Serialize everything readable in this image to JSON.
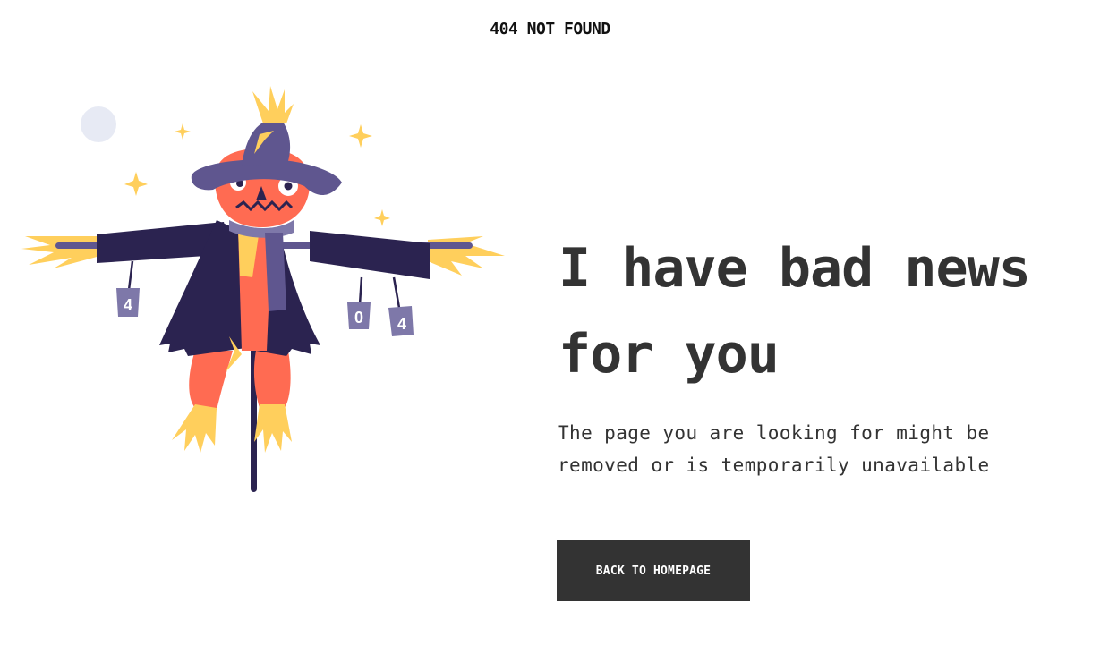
{
  "header": {
    "title": "404 NOT FOUND"
  },
  "illustration": {
    "icon": "scarecrow-illustration",
    "can_labels": [
      "4",
      "0",
      "4"
    ],
    "colors": {
      "hat": "#5f568f",
      "coat": "#2b2350",
      "face": "#ff6b52",
      "straw": "#ffcf5c",
      "can": "#7e78a9",
      "moon": "#e7eaf4"
    }
  },
  "main": {
    "headline_line1": "I have bad news",
    "headline_line2": "for you",
    "description_line1": "The page you are looking for might be",
    "description_line2": "removed or is temporarily unavailable",
    "button_label": "BACK TO HOMEPAGE"
  },
  "colors": {
    "text": "#333333",
    "button_bg": "#333333",
    "button_text": "#ffffff",
    "background": "#ffffff"
  }
}
